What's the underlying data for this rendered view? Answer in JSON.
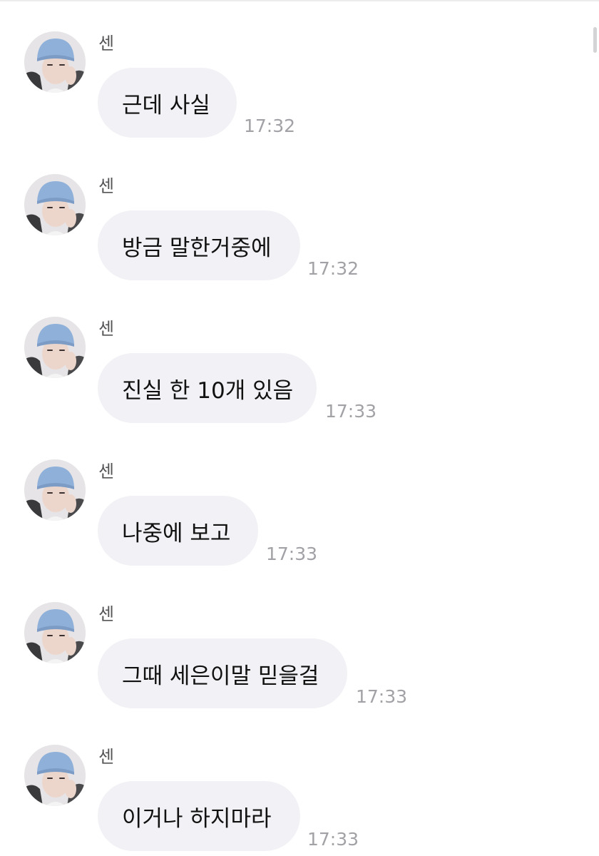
{
  "messages": [
    {
      "sender": "센",
      "text": "근데 사실",
      "time": "17:32"
    },
    {
      "sender": "센",
      "text": "방금 말한거중에",
      "time": "17:32"
    },
    {
      "sender": "센",
      "text": "진실 한 10개 있음",
      "time": "17:33"
    },
    {
      "sender": "센",
      "text": "나중에 보고",
      "time": "17:33"
    },
    {
      "sender": "센",
      "text": "그때 세은이말 믿을걸",
      "time": "17:33"
    },
    {
      "sender": "센",
      "text": "이거나 하지마라",
      "time": "17:33"
    }
  ],
  "colors": {
    "bubble": "#f2f2f6",
    "time": "#a2a2a6",
    "sender": "#555558",
    "beanie": "#8fb0d8"
  },
  "icons": {
    "avatar": "profile-photo"
  }
}
